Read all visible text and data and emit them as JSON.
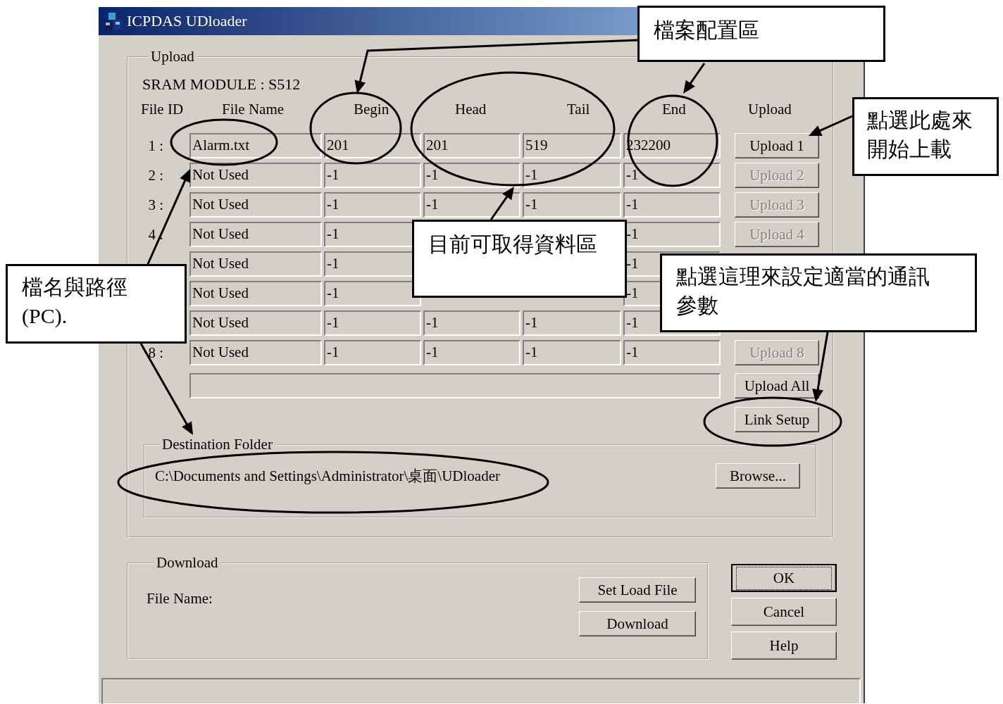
{
  "window": {
    "title": "ICPDAS UDloader"
  },
  "upload": {
    "title": "Upload",
    "module": "SRAM MODULE : S512",
    "columns": [
      "File ID",
      "File Name",
      "Begin",
      "Head",
      "Tail",
      "End",
      "Upload"
    ],
    "rows": [
      {
        "id": "1 :",
        "cells": [
          "Alarm.txt",
          "201",
          "201",
          "519",
          "232200"
        ],
        "button": {
          "label": "Upload 1",
          "disabled": false
        }
      },
      {
        "id": "2 :",
        "cells": [
          "Not Used",
          "-1",
          "-1",
          "-1",
          "-1"
        ],
        "button": {
          "label": "Upload 2",
          "disabled": true
        }
      },
      {
        "id": "3 :",
        "cells": [
          "Not Used",
          "-1",
          "-1",
          "-1",
          "-1"
        ],
        "button": {
          "label": "Upload 3",
          "disabled": true
        }
      },
      {
        "id": "4 :",
        "cells": [
          "Not Used",
          "-1",
          null,
          null,
          "-1"
        ],
        "button": {
          "label": "Upload 4",
          "disabled": true
        }
      },
      {
        "id": null,
        "cells": [
          "Not Used",
          "-1",
          null,
          null,
          "-1"
        ],
        "button": null
      },
      {
        "id": null,
        "cells": [
          "Not Used",
          "-1",
          null,
          null,
          "-1"
        ],
        "button": null
      },
      {
        "id": null,
        "cells": [
          "Not Used",
          "-1",
          "-1",
          "-1",
          "-1"
        ],
        "button": null
      },
      {
        "id": "8 :",
        "cells": [
          "Not Used",
          "-1",
          "-1",
          "-1",
          "-1"
        ],
        "button": {
          "label": "Upload 8",
          "disabled": true
        }
      }
    ],
    "upload_all": {
      "label": "Upload All"
    },
    "link_setup": {
      "label": "Link Setup"
    },
    "destination": {
      "title": "Destination Folder",
      "path": "C:\\Documents and Settings\\Administrator\\桌面\\UDloader",
      "browse": {
        "label": "Browse..."
      }
    }
  },
  "download": {
    "title": "Download",
    "file_label": "File Name:",
    "buttons": [
      {
        "label": "Set Load File"
      },
      {
        "label": "Download"
      }
    ]
  },
  "dialog_buttons": [
    {
      "label": "OK",
      "default": true
    },
    {
      "label": "Cancel",
      "default": false
    },
    {
      "label": "Help",
      "default": false
    }
  ],
  "callouts": [
    {
      "text": "檔案配置區"
    },
    {
      "text": "點選此處來開始上載"
    },
    {
      "text": "目前可取得資料區"
    },
    {
      "text": "檔名與路徑 (PC)."
    },
    {
      "text": "點選這理來設定適當的通訊參數"
    }
  ]
}
